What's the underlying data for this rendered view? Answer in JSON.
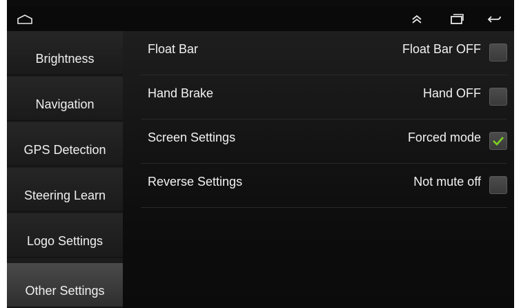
{
  "status_bar": {
    "icons": [
      "home-icon",
      "double-chevron-up-icon",
      "recent-apps-icon",
      "back-icon"
    ]
  },
  "sidebar": {
    "items": [
      {
        "label": "Brightness",
        "active": false
      },
      {
        "label": "Navigation",
        "active": false
      },
      {
        "label": "GPS Detection",
        "active": false
      },
      {
        "label": "Steering Learn",
        "active": false
      },
      {
        "label": "Logo Settings",
        "active": false
      },
      {
        "label": "Other Settings",
        "active": true
      }
    ]
  },
  "settings": {
    "rows": [
      {
        "label": "Float Bar",
        "value": "Float Bar OFF",
        "checked": false
      },
      {
        "label": "Hand Brake",
        "value": "Hand OFF",
        "checked": false
      },
      {
        "label": "Screen Settings",
        "value": "Forced mode",
        "checked": true
      },
      {
        "label": "Reverse Settings",
        "value": "Not mute off",
        "checked": false
      }
    ]
  },
  "colors": {
    "check_mark": "#7fd321",
    "text": "#f2f2f2",
    "background": "#0c0c0c"
  }
}
